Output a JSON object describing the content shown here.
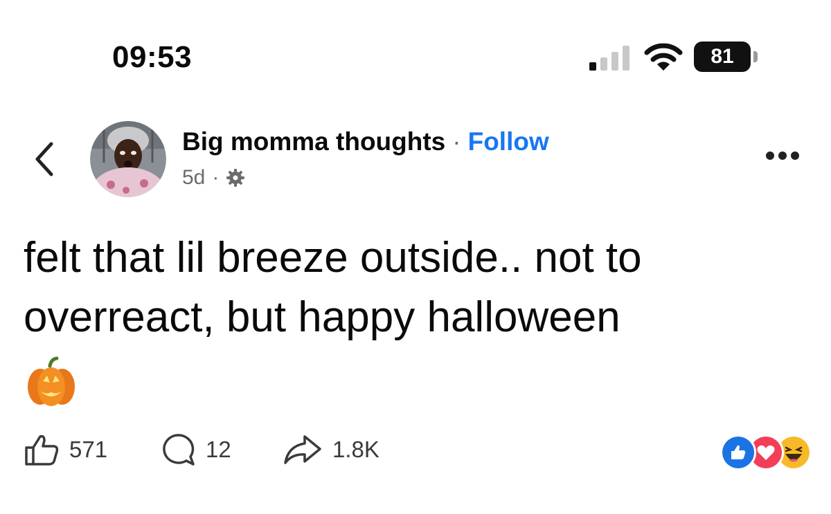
{
  "status_bar": {
    "time": "09:53",
    "battery": "81",
    "icons": [
      "signal-icon",
      "wifi-icon",
      "battery-icon"
    ]
  },
  "post": {
    "author": "Big momma thoughts",
    "separator": "·",
    "follow_label": "Follow",
    "age": "5d",
    "meta_separator": "·",
    "text": "felt that lil breeze outside.. not to overreact, but happy halloween",
    "emoji": "pumpkin-icon"
  },
  "actions": {
    "likes": "571",
    "comments": "12",
    "shares": "1.8K"
  },
  "reactions": [
    "like-reaction-icon",
    "love-reaction-icon",
    "haha-reaction-icon"
  ],
  "colors": {
    "accent": "#1877f2",
    "text": "#0a0a0a",
    "muted": "#6b6b6b"
  }
}
